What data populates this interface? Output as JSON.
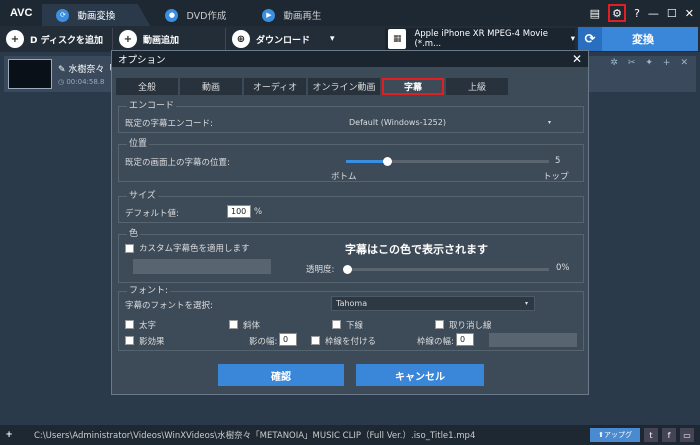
{
  "app": {
    "logo": "AVC"
  },
  "tabs": [
    {
      "label": "動画変換",
      "icon": "refresh-icon"
    },
    {
      "label": "DVD作成",
      "icon": "disc-icon"
    },
    {
      "label": "動画再生",
      "icon": "play-icon"
    }
  ],
  "window": {
    "help": "?",
    "minimize": "—",
    "maximize": "☐",
    "close": "✕"
  },
  "toolbar": {
    "disc_add": "ディスクを追加",
    "disc_prefix": "D",
    "video_add": "動画追加",
    "download": "ダウンロード",
    "profile": "Apple iPhone XR MPEG-4 Movie (*.m...",
    "convert": "変換"
  },
  "file": {
    "name": "水樹奈々「",
    "time": "00:04:58.8"
  },
  "status": {
    "path": "C:\\Users\\Administrator\\Videos\\WinXVideos\\水樹奈々「METANOIA」MUSIC CLIP（Full Ver.）.iso_Title1.mp4",
    "upgrade": "アップグ",
    "plus": "+"
  },
  "dialog": {
    "title": "オプション",
    "close": "✕",
    "tabs": [
      "全般",
      "動画",
      "オーディオ",
      "オンライン動画",
      "字幕",
      "上級"
    ],
    "active_tab": "字幕",
    "encode": {
      "title": "エンコード",
      "label": "既定の字幕エンコード:",
      "value": "Default (Windows-1252)"
    },
    "position": {
      "title": "位置",
      "label": "既定の画面上の字幕の位置:",
      "min": "ボトム",
      "max": "トップ",
      "value_label": "5",
      "value": 0.2
    },
    "size": {
      "title": "サイズ",
      "label": "デフォルト値:",
      "value": "100",
      "unit": "%"
    },
    "color": {
      "title": "色",
      "custom": "カスタム字幕色を適用します",
      "preview": "字幕はこの色で表示されます",
      "opacity_label": "透明度:",
      "opacity_value": "0%",
      "opacity": 0.0
    },
    "font": {
      "title": "フォント:",
      "label": "字幕のフォントを選択:",
      "value": "Tahoma",
      "bold": "太字",
      "italic": "斜体",
      "underline": "下線",
      "strike": "取り消し線",
      "shadow": "影効果",
      "shadow_width": "影の幅:",
      "shadow_value": "0",
      "outline": "枠線を付ける",
      "outline_width": "枠線の幅:",
      "outline_value": "0"
    },
    "ok": "確認",
    "cancel": "キャンセル"
  }
}
